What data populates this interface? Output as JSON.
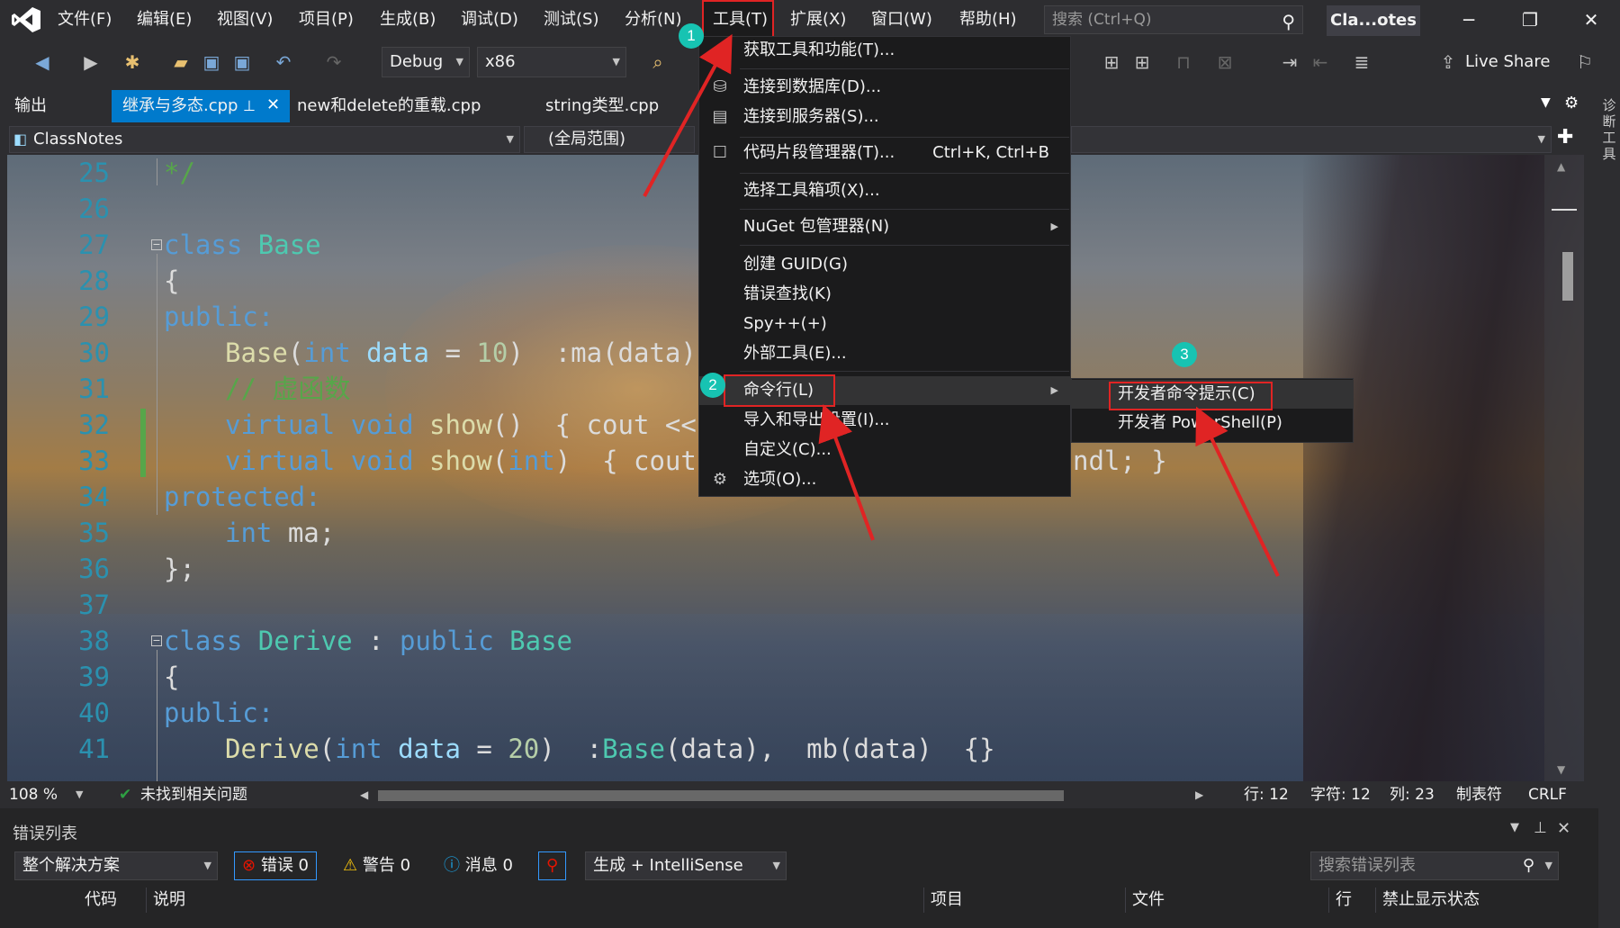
{
  "menubar": {
    "items": [
      "文件(F)",
      "编辑(E)",
      "视图(V)",
      "项目(P)",
      "生成(B)",
      "调试(D)",
      "测试(S)",
      "分析(N)",
      "工具(T)",
      "扩展(X)",
      "窗口(W)",
      "帮助(H)"
    ],
    "search_placeholder": "搜索 (Ctrl+Q)",
    "solution_title": "Cla...otes",
    "window_buttons": [
      "─",
      "❐",
      "✕"
    ]
  },
  "toolbar": {
    "config": "Debug",
    "platform": "x86",
    "live_share": "Live Share"
  },
  "tabs": {
    "output": "输出",
    "active": "继承与多态.cpp",
    "others": [
      "new和delete的重载.cpp",
      "string类型.cpp"
    ]
  },
  "navbar": {
    "project": "ClassNotes",
    "scope": "(全局范围)"
  },
  "editor": {
    "line_numbers": [
      "25",
      "26",
      "27",
      "28",
      "29",
      "30",
      "31",
      "32",
      "33",
      "34",
      "35",
      "36",
      "37",
      "38",
      "39",
      "40",
      "41"
    ],
    "zoom": "108 %",
    "issues": "未找到相关问题",
    "position": {
      "line": "行: 12",
      "char": "字符: 12",
      "col": "列: 23",
      "tabs": "制表符",
      "eol": "CRLF"
    }
  },
  "code": {
    "l25": "*/",
    "l27_kw": "class",
    "l27_name": "Base",
    "l28": "{",
    "l29": "public:",
    "l30_fn": "Base",
    "l30_p1": "(",
    "l30_kw": "int",
    "l30_pm": "data",
    "l30_eq": " = ",
    "l30_nm": "10",
    "l30_rest": ")  :ma(data)  {",
    "l31": "// 虚函数",
    "l32_kw1": "virtual",
    "l32_kw2": "void",
    "l32_fn": "show",
    "l32_rest": "()  { cout << \"",
    "l33_kw1": "virtual",
    "l33_kw2": "void",
    "l33_fn": "show",
    "l33_p": "(",
    "l33_kw3": "int",
    "l33_rest": ")  { cout <",
    "l33_tail": "ndl; }",
    "l34": "protected:",
    "l35_kw": "int",
    "l35_rest": " ma;",
    "l36": "};",
    "l38_kw": "class",
    "l38_name": "Derive",
    "l38_colon": " : ",
    "l38_kw2": "public",
    "l38_base": "Base",
    "l39": "{",
    "l40": "public:",
    "l41_fn": "Derive",
    "l41_p1": "(",
    "l41_kw": "int",
    "l41_pm": "data",
    "l41_eq": " = ",
    "l41_nm": "20",
    "l41_p2": ")  :",
    "l41_base": "Base",
    "l41_rest": "(data),  mb(data)  {}"
  },
  "tools_menu": {
    "items": [
      {
        "label": "获取工具和功能(T)..."
      },
      {
        "label": "连接到数据库(D)..."
      },
      {
        "label": "连接到服务器(S)..."
      },
      {
        "label": "代码片段管理器(T)...",
        "shortcut": "Ctrl+K, Ctrl+B"
      },
      {
        "label": "选择工具箱项(X)..."
      },
      {
        "label": "NuGet 包管理器(N)"
      },
      {
        "label": "创建 GUID(G)"
      },
      {
        "label": "错误查找(K)"
      },
      {
        "label": "Spy++(+)"
      },
      {
        "label": "外部工具(E)..."
      },
      {
        "label": "命令行(L)"
      },
      {
        "label": "导入和导出设置(I)..."
      },
      {
        "label": "自定义(C)..."
      },
      {
        "label": "选项(O)..."
      }
    ]
  },
  "submenu": {
    "items": [
      "开发者命令提示(C)",
      "开发者 PowerShell(P)"
    ]
  },
  "annotations": {
    "badges": [
      "1",
      "2",
      "3"
    ],
    "color": "#e02424",
    "badge_color": "#17c3b2"
  },
  "error_list": {
    "title": "错误列表",
    "scope": "整个解决方案",
    "errors": "错误 0",
    "warnings": "警告 0",
    "messages": "消息 0",
    "build_filter": "生成 + IntelliSense",
    "search_placeholder": "搜索错误列表",
    "columns": [
      "代码",
      "说明",
      "项目",
      "文件",
      "行",
      "禁止显示状态"
    ]
  },
  "side_strip": {
    "label": "诊断工具"
  }
}
